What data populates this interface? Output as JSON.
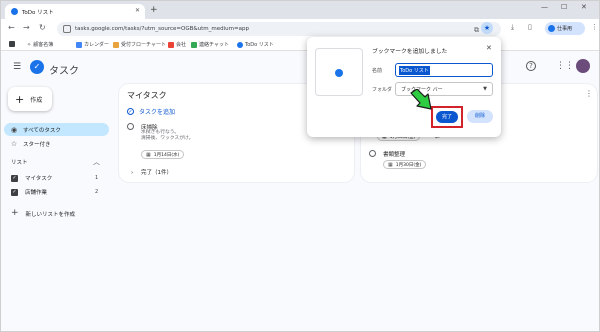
{
  "browser": {
    "tab_title": "ToDo リスト",
    "url": "tasks.google.com/tasks/?utm_source=OGB&utm_medium=app",
    "profile_label": "仕事用"
  },
  "bookmarks": [
    {
      "label": "",
      "icon": "nav-app-icon"
    },
    {
      "label": "顧客名簿",
      "icon": "star-bookmark-icon"
    },
    {
      "label": "カレンダー",
      "icon": "calendar-icon"
    },
    {
      "label": "受付フローチャート",
      "icon": "flowchart-icon"
    },
    {
      "label": "会社",
      "icon": "gmail-icon"
    },
    {
      "label": "連絡チャット",
      "icon": "chat-icon"
    },
    {
      "label": "ToDo リスト",
      "icon": "tasks-icon"
    }
  ],
  "app": {
    "name": "タスク",
    "create_label": "作成"
  },
  "sidebar": {
    "items": [
      {
        "label": "すべてのタスク",
        "icon": "check-circle-icon"
      },
      {
        "label": "スター付き",
        "icon": "star-icon"
      }
    ],
    "lists_header": "リスト",
    "lists": [
      {
        "label": "マイタスク",
        "count": "1"
      },
      {
        "label": "店舗作業",
        "count": "2"
      }
    ],
    "new_list_label": "新しいリストを作成"
  },
  "cards": {
    "mytasks": {
      "title": "マイタスク",
      "add_task_label": "タスクを追加",
      "task": {
        "title": "床掃除",
        "desc_line1": "水拭きも行なう。",
        "desc_line2": "清掃後、ワックスがけ。",
        "date": "1月14日(水)"
      },
      "completed_label": "完了（1件）"
    },
    "store": {
      "tasks": [
        {
          "title": "",
          "date": "1月30日(金)"
        },
        {
          "title": "書類整理",
          "date": "1月30日(金)"
        }
      ]
    }
  },
  "popup": {
    "title": "ブックマークを追加しました",
    "name_label": "名前",
    "name_value": "ToDo リスト",
    "folder_label": "フォルダ",
    "folder_value": "ブックマーク バー",
    "done_label": "完了",
    "delete_label": "削除"
  },
  "colors": {
    "accent": "#0b57d0",
    "highlight_box": "#d2232a",
    "arrow_green": "#2ecc40",
    "active_nav": "#c2e7ff"
  }
}
